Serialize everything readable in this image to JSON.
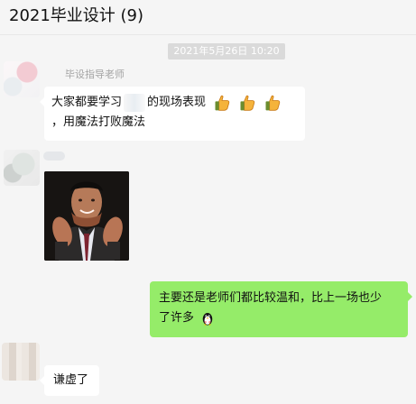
{
  "header": {
    "title": "2021毕业设计 (9)"
  },
  "chat": {
    "timestamp": "2021年5月26日 10:20",
    "sender_name": "毕设指导老师",
    "messages": [
      {
        "line1_prefix": "大家都要学习",
        "line1_suffix": "的现场表现",
        "line2": "，用魔法打败魔法"
      },
      {
        "line1": "主要还是老师们都比较温和，比上一场也少",
        "line2": "了许多"
      },
      {
        "text": "谦虚了"
      }
    ]
  },
  "icons": {
    "thumbs_up": "thumbs-up-icon",
    "penguin": "qq-penguin-icon"
  },
  "colors": {
    "sent_bubble": "#95ec69",
    "received_bubble": "#ffffff",
    "background": "#f5f5f5"
  }
}
